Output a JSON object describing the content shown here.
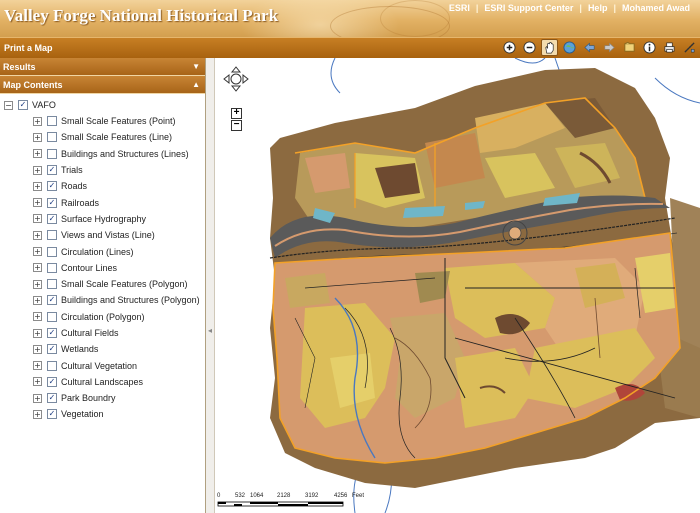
{
  "header": {
    "title": "Valley Forge National Historical Park",
    "links": [
      "ESRI",
      "ESRI Support Center",
      "Help",
      "Mohamed Awad"
    ]
  },
  "toolbar": {
    "print_label": "Print a Map",
    "tools": [
      "zoom-in-icon",
      "zoom-out-icon",
      "pan-hand-icon",
      "full-extent-icon",
      "back-arrow-icon",
      "forward-arrow-icon",
      "layers-icon",
      "info-icon",
      "print-icon",
      "measure-icon"
    ]
  },
  "panel": {
    "results_label": "Results",
    "map_contents_label": "Map Contents",
    "root_label": "VAFO",
    "layers": [
      {
        "label": "Small Scale Features (Point)",
        "checked": false
      },
      {
        "label": "Small Scale Features (Line)",
        "checked": false
      },
      {
        "label": "Buildings and Structures (Lines)",
        "checked": false
      },
      {
        "label": "Trials",
        "checked": true
      },
      {
        "label": "Roads",
        "checked": true
      },
      {
        "label": "Railroads",
        "checked": true
      },
      {
        "label": "Surface Hydrography",
        "checked": true
      },
      {
        "label": "Views and Vistas (Line)",
        "checked": false
      },
      {
        "label": "Circulation (Lines)",
        "checked": false
      },
      {
        "label": "Contour Lines",
        "checked": false
      },
      {
        "label": "Small Scale Features (Polygon)",
        "checked": false
      },
      {
        "label": "Buildings and Structures (Polygon)",
        "checked": true
      },
      {
        "label": "Circulation (Polygon)",
        "checked": false
      },
      {
        "label": "Cultural Fields",
        "checked": true
      },
      {
        "label": "Wetlands",
        "checked": true
      },
      {
        "label": "Cultural Vegetation",
        "checked": false
      },
      {
        "label": "Cultural Landscapes",
        "checked": true
      },
      {
        "label": "Park Boundry",
        "checked": true
      },
      {
        "label": "Vegetation",
        "checked": true
      }
    ]
  },
  "map": {
    "scale_labels": [
      "0",
      "532",
      "1064",
      "2128",
      "3192",
      "4256",
      "Feet"
    ],
    "colors": {
      "park": "#d8c35e",
      "field": "#dcbe5a",
      "orange": "#d59a6e",
      "brown": "#8c6a40",
      "darkbrown": "#6e4a30",
      "olive": "#a08a50",
      "boundary": "#f3a127",
      "water": "#6fb6c8",
      "river": "#5a5a5a"
    }
  }
}
